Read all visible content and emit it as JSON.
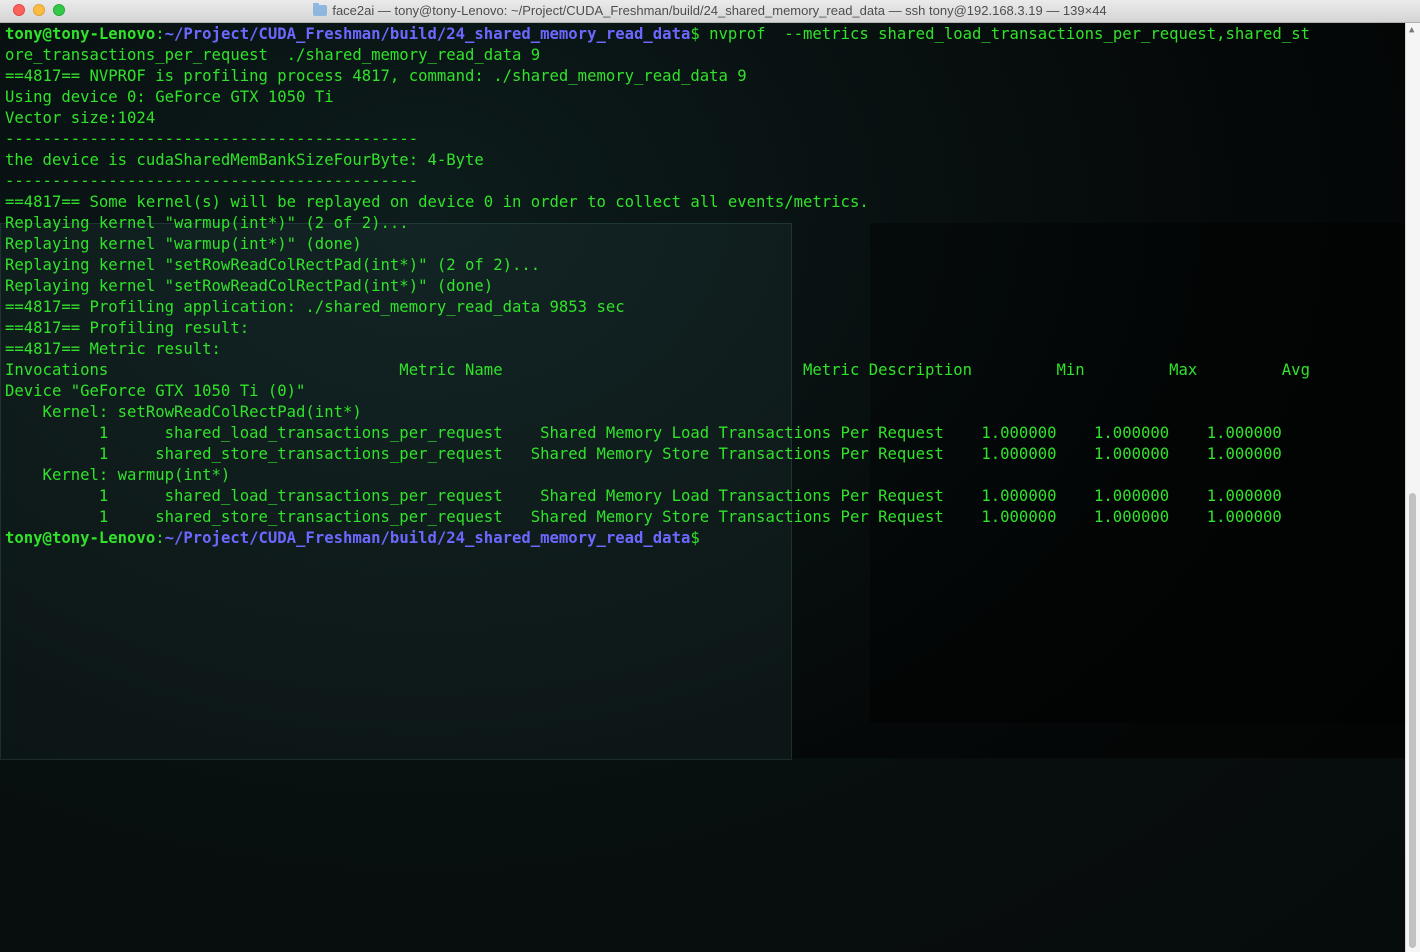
{
  "window": {
    "title": "face2ai — tony@tony-Lenovo: ~/Project/CUDA_Freshman/build/24_shared_memory_read_data — ssh tony@192.168.3.19 — 139×44"
  },
  "prompt": {
    "user_host": "tony@tony-Lenovo",
    "path": "~/Project/CUDA_Freshman/build/24_shared_memory_read_data",
    "symbol": "$"
  },
  "command": {
    "part1": " nvprof  --metrics shared_load_transactions_per_request,shared_st",
    "part2": "ore_transactions_per_request  ./shared_memory_read_data 9"
  },
  "output": [
    "==4817== NVPROF is profiling process 4817, command: ./shared_memory_read_data 9",
    "Using device 0: GeForce GTX 1050 Ti",
    "Vector size:1024",
    "--------------------------------------------",
    "the device is cudaSharedMemBankSizeFourByte: 4-Byte",
    "--------------------------------------------",
    "==4817== Some kernel(s) will be replayed on device 0 in order to collect all events/metrics.",
    "Replaying kernel \"warmup(int*)\" (2 of 2)...",
    "Replaying kernel \"warmup(int*)\" (done)",
    "Replaying kernel \"setRowReadColRectPad(int*)\" (2 of 2)...",
    "Replaying kernel \"setRowReadColRectPad(int*)\" (done)",
    "==4817== Profiling application: ./shared_memory_read_data 9853 sec",
    "==4817== Profiling result:",
    "==4817== Metric result:",
    "Invocations                               Metric Name                                Metric Description         Min         Max         Avg",
    "Device \"GeForce GTX 1050 Ti (0)\"",
    "    Kernel: setRowReadColRectPad(int*)",
    "          1      shared_load_transactions_per_request    Shared Memory Load Transactions Per Request    1.000000    1.000000    1.000000",
    "          1     shared_store_transactions_per_request   Shared Memory Store Transactions Per Request    1.000000    1.000000    1.000000",
    "    Kernel: warmup(int*)",
    "          1      shared_load_transactions_per_request    Shared Memory Load Transactions Per Request    1.000000    1.000000    1.000000",
    "          1     shared_store_transactions_per_request   Shared Memory Store Transactions Per Request    1.000000    1.000000    1.000000"
  ],
  "colors": {
    "text_green": "#31e22b",
    "path_blue": "#6c68ff",
    "background": "#050808"
  }
}
